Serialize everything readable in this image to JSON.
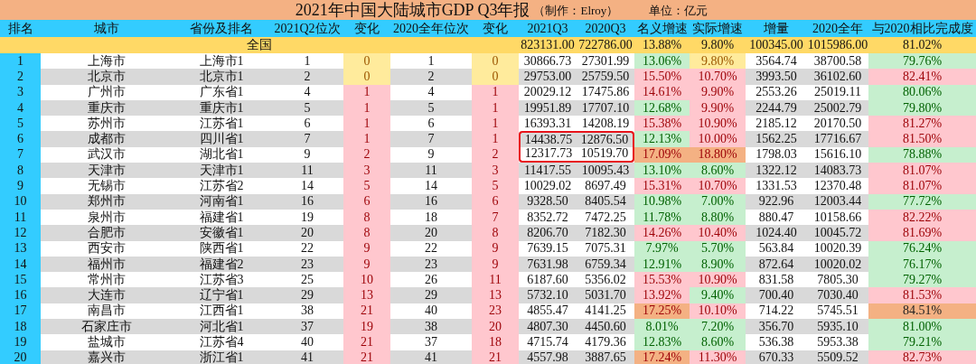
{
  "title": {
    "main": "2021年中国大陆城市GDP Q3年报",
    "author": "（制作：Elroy）",
    "unit": "单位：亿元"
  },
  "columns": [
    "排名",
    "城市",
    "省份及排名",
    "2021Q2位次",
    "变化",
    "2020全年位次",
    "变化",
    "2021Q3",
    "2020Q3",
    "名义增速",
    "实际增速",
    "增量",
    "2020全年",
    "与2020相比完成度"
  ],
  "total_row": {
    "label": "全国",
    "values": [
      "823131.00",
      "722786.00",
      "13.88%",
      "9.80%",
      "100345.00",
      "1015986.00",
      "81.02%"
    ]
  },
  "rows": [
    {
      "boxed": false,
      "cells": [
        "1",
        "上海市",
        "上海市1",
        "1",
        {
          "text": "0",
          "color": "#ffeb9c"
        },
        "1",
        {
          "text": "0",
          "color": "#ffeb9c"
        },
        "30866.73",
        "27301.99",
        {
          "text": "13.06%",
          "color": "#c6efce"
        },
        {
          "text": "9.80%",
          "color": "#ffeb9c"
        },
        "3564.74",
        "38700.58",
        {
          "text": "79.76%",
          "color": "#c6efce"
        }
      ]
    },
    {
      "boxed": false,
      "cells": [
        "2",
        "北京市",
        "北京市1",
        "2",
        {
          "text": "0",
          "color": "#ffeb9c"
        },
        "2",
        {
          "text": "0",
          "color": "#ffeb9c"
        },
        "29753.00",
        "25759.50",
        {
          "text": "15.50%",
          "color": "#ffc7ce"
        },
        {
          "text": "10.70%",
          "color": "#ffc7ce"
        },
        "3993.50",
        "36102.60",
        {
          "text": "82.41%",
          "color": "#ffc7ce"
        }
      ]
    },
    {
      "boxed": false,
      "cells": [
        "3",
        "广州市",
        "广东省1",
        "4",
        {
          "text": "1",
          "color": "#ffc7ce"
        },
        "4",
        {
          "text": "1",
          "color": "#ffc7ce"
        },
        "20029.12",
        "17475.86",
        {
          "text": "14.61%",
          "color": "#ffc7ce"
        },
        {
          "text": "9.90%",
          "color": "#ffc7ce"
        },
        "2553.26",
        "25019.11",
        {
          "text": "80.06%",
          "color": "#c6efce"
        }
      ]
    },
    {
      "boxed": false,
      "cells": [
        "4",
        "重庆市",
        "重庆市1",
        "5",
        {
          "text": "1",
          "color": "#ffc7ce"
        },
        "5",
        {
          "text": "1",
          "color": "#ffc7ce"
        },
        "19951.89",
        "17707.10",
        {
          "text": "12.68%",
          "color": "#c6efce"
        },
        {
          "text": "9.90%",
          "color": "#ffc7ce"
        },
        "2244.79",
        "25002.79",
        {
          "text": "79.80%",
          "color": "#c6efce"
        }
      ]
    },
    {
      "boxed": false,
      "cells": [
        "5",
        "苏州市",
        "江苏省1",
        "6",
        {
          "text": "1",
          "color": "#ffc7ce"
        },
        "6",
        {
          "text": "1",
          "color": "#ffc7ce"
        },
        "16393.31",
        "14208.19",
        {
          "text": "15.38%",
          "color": "#ffc7ce"
        },
        {
          "text": "10.90%",
          "color": "#ffc7ce"
        },
        "2185.12",
        "20170.50",
        {
          "text": "81.27%",
          "color": "#ffc7ce"
        }
      ]
    },
    {
      "boxed": true,
      "cells": [
        "6",
        "成都市",
        "四川省1",
        "7",
        {
          "text": "1",
          "color": "#ffc7ce"
        },
        "7",
        {
          "text": "1",
          "color": "#ffc7ce"
        },
        "14438.75",
        "12876.50",
        {
          "text": "12.13%",
          "color": "#c6efce"
        },
        {
          "text": "10.00%",
          "color": "#ffc7ce"
        },
        "1562.25",
        "17716.67",
        {
          "text": "81.50%",
          "color": "#ffc7ce"
        }
      ]
    },
    {
      "boxed": true,
      "cells": [
        "7",
        "武汉市",
        "湖北省1",
        "9",
        {
          "text": "2",
          "color": "#ffc7ce"
        },
        "9",
        {
          "text": "2",
          "color": "#ffc7ce"
        },
        "12317.73",
        "10519.70",
        {
          "text": "17.09%",
          "color": "#f4b183"
        },
        {
          "text": "18.80%",
          "color": "#f4b183"
        },
        "1798.03",
        "15616.10",
        {
          "text": "78.88%",
          "color": "#c6efce"
        }
      ]
    },
    {
      "boxed": false,
      "cells": [
        "8",
        "天津市",
        "天津市1",
        "11",
        {
          "text": "3",
          "color": "#ffc7ce"
        },
        "11",
        {
          "text": "3",
          "color": "#ffc7ce"
        },
        "11417.55",
        "10095.43",
        {
          "text": "13.10%",
          "color": "#c6efce"
        },
        {
          "text": "8.60%",
          "color": "#c6efce"
        },
        "1322.12",
        "14083.73",
        {
          "text": "81.07%",
          "color": "#ffc7ce"
        }
      ]
    },
    {
      "boxed": false,
      "cells": [
        "9",
        "无锡市",
        "江苏省2",
        "14",
        {
          "text": "5",
          "color": "#ffc7ce"
        },
        "14",
        {
          "text": "5",
          "color": "#ffc7ce"
        },
        "10029.02",
        "8697.49",
        {
          "text": "15.31%",
          "color": "#ffc7ce"
        },
        {
          "text": "10.70%",
          "color": "#ffc7ce"
        },
        "1331.53",
        "12370.48",
        {
          "text": "81.07%",
          "color": "#ffc7ce"
        }
      ]
    },
    {
      "boxed": false,
      "cells": [
        "10",
        "郑州市",
        "河南省1",
        "16",
        {
          "text": "6",
          "color": "#ffc7ce"
        },
        "16",
        {
          "text": "6",
          "color": "#ffc7ce"
        },
        "9328.50",
        "8405.54",
        {
          "text": "10.98%",
          "color": "#c6efce"
        },
        {
          "text": "7.00%",
          "color": "#c6efce"
        },
        "922.96",
        "12003.44",
        {
          "text": "77.72%",
          "color": "#c6efce"
        }
      ]
    },
    {
      "boxed": false,
      "cells": [
        "11",
        "泉州市",
        "福建省1",
        "19",
        {
          "text": "8",
          "color": "#ffc7ce"
        },
        "18",
        {
          "text": "7",
          "color": "#ffc7ce"
        },
        "8352.72",
        "7472.25",
        {
          "text": "11.78%",
          "color": "#c6efce"
        },
        {
          "text": "8.80%",
          "color": "#c6efce"
        },
        "880.47",
        "10158.66",
        {
          "text": "82.22%",
          "color": "#ffc7ce"
        }
      ]
    },
    {
      "boxed": false,
      "cells": [
        "12",
        "合肥市",
        "安徽省1",
        "20",
        {
          "text": "8",
          "color": "#ffc7ce"
        },
        "20",
        {
          "text": "8",
          "color": "#ffc7ce"
        },
        "8206.70",
        "7182.30",
        {
          "text": "14.26%",
          "color": "#ffc7ce"
        },
        {
          "text": "10.40%",
          "color": "#ffc7ce"
        },
        "1024.40",
        "10045.72",
        {
          "text": "81.69%",
          "color": "#ffc7ce"
        }
      ]
    },
    {
      "boxed": false,
      "cells": [
        "13",
        "西安市",
        "陕西省1",
        "22",
        {
          "text": "9",
          "color": "#ffc7ce"
        },
        "22",
        {
          "text": "9",
          "color": "#ffc7ce"
        },
        "7639.15",
        "7075.31",
        {
          "text": "7.97%",
          "color": "#c6efce"
        },
        {
          "text": "5.70%",
          "color": "#c6efce"
        },
        "563.84",
        "10020.39",
        {
          "text": "76.24%",
          "color": "#c6efce"
        }
      ]
    },
    {
      "boxed": false,
      "cells": [
        "14",
        "福州市",
        "福建省2",
        "23",
        {
          "text": "9",
          "color": "#ffc7ce"
        },
        "23",
        {
          "text": "9",
          "color": "#ffc7ce"
        },
        "7631.98",
        "6759.34",
        {
          "text": "12.91%",
          "color": "#c6efce"
        },
        {
          "text": "8.90%",
          "color": "#c6efce"
        },
        "872.64",
        "10020.02",
        {
          "text": "76.17%",
          "color": "#c6efce"
        }
      ]
    },
    {
      "boxed": false,
      "cells": [
        "15",
        "常州市",
        "江苏省3",
        "25",
        {
          "text": "10",
          "color": "#ffc7ce"
        },
        "26",
        {
          "text": "11",
          "color": "#ffc7ce"
        },
        "6187.60",
        "5356.02",
        {
          "text": "15.53%",
          "color": "#ffc7ce"
        },
        {
          "text": "10.90%",
          "color": "#ffc7ce"
        },
        "831.58",
        "7805.30",
        {
          "text": "79.27%",
          "color": "#c6efce"
        }
      ]
    },
    {
      "boxed": false,
      "cells": [
        "16",
        "大连市",
        "辽宁省1",
        "29",
        {
          "text": "13",
          "color": "#ffc7ce"
        },
        "29",
        {
          "text": "13",
          "color": "#ffc7ce"
        },
        "5732.10",
        "5031.70",
        {
          "text": "13.92%",
          "color": "#ffc7ce"
        },
        {
          "text": "9.40%",
          "color": "#c6efce"
        },
        "700.40",
        "7030.40",
        {
          "text": "81.53%",
          "color": "#ffc7ce"
        }
      ]
    },
    {
      "boxed": false,
      "cells": [
        "17",
        "南昌市",
        "江西省1",
        "38",
        {
          "text": "21",
          "color": "#ffc7ce"
        },
        "40",
        {
          "text": "23",
          "color": "#ffc7ce"
        },
        "4855.47",
        "4141.25",
        {
          "text": "17.25%",
          "color": "#f4b183"
        },
        {
          "text": "10.10%",
          "color": "#ffc7ce"
        },
        "714.22",
        "5745.51",
        {
          "text": "84.51%",
          "color": "#f4b183"
        }
      ]
    },
    {
      "boxed": false,
      "cells": [
        "18",
        "石家庄市",
        "河北省1",
        "37",
        {
          "text": "19",
          "color": "#ffc7ce"
        },
        "38",
        {
          "text": "20",
          "color": "#ffc7ce"
        },
        "4807.30",
        "4450.60",
        {
          "text": "8.01%",
          "color": "#c6efce"
        },
        {
          "text": "7.20%",
          "color": "#c6efce"
        },
        "356.70",
        "5935.10",
        {
          "text": "81.00%",
          "color": "#c6efce"
        }
      ]
    },
    {
      "boxed": false,
      "cells": [
        "19",
        "盐城市",
        "江苏省4",
        "40",
        {
          "text": "21",
          "color": "#ffc7ce"
        },
        "37",
        {
          "text": "18",
          "color": "#ffc7ce"
        },
        "4715.74",
        "4179.36",
        {
          "text": "12.83%",
          "color": "#c6efce"
        },
        {
          "text": "8.60%",
          "color": "#c6efce"
        },
        "536.38",
        "5953.38",
        {
          "text": "79.21%",
          "color": "#c6efce"
        }
      ]
    },
    {
      "boxed": false,
      "cells": [
        "20",
        "嘉兴市",
        "浙江省1",
        "41",
        {
          "text": "21",
          "color": "#ffc7ce"
        },
        "41",
        {
          "text": "21",
          "color": "#ffc7ce"
        },
        "4557.98",
        "3887.65",
        {
          "text": "17.24%",
          "color": "#f4b183"
        },
        {
          "text": "11.30%",
          "color": "#ffc7ce"
        },
        "670.33",
        "5509.52",
        {
          "text": "82.73%",
          "color": "#ffc7ce"
        }
      ]
    }
  ]
}
